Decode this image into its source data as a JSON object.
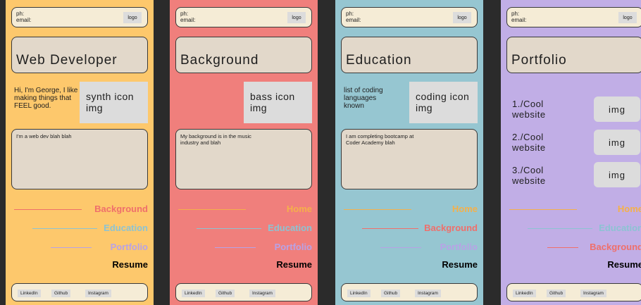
{
  "colors": {
    "dark_bg": "#2b2b2b",
    "orange": "#fdc86c",
    "red": "#f07f7c",
    "blue": "#96c6d1",
    "purple": "#c1aee6",
    "nav_orange": "#f5b04a",
    "nav_red": "#ef6f6b",
    "nav_blue": "#8cc3d3",
    "nav_purple": "#b8a2e6"
  },
  "header": {
    "ph_label": "ph:",
    "email_label": "email:",
    "logo": "logo"
  },
  "footer": {
    "linkedin": "LinkedIn",
    "github": "Github",
    "instagram": "Instagram"
  },
  "panels": [
    {
      "title": "Web Developer",
      "intro": "Hi, I'm George, I like making things that FEEL good.",
      "icon": "synth icon img",
      "description": "I'm a web dev blah blah",
      "nav": [
        "Background",
        "Education",
        "Portfolio",
        "Resume"
      ]
    },
    {
      "title": "Background",
      "icon": "bass icon img",
      "description": "My background is in the music industry and blah",
      "nav": [
        "Home",
        "Education",
        "Portfolio",
        "Resume"
      ]
    },
    {
      "title": "Education",
      "intro": "list of coding languages known",
      "icon": "coding icon img",
      "description": "I am completing bootcamp at Coder Academy blah",
      "nav": [
        "Home",
        "Background",
        "Portfolio",
        "Resume"
      ]
    },
    {
      "title": "Portfolio",
      "items": [
        "1./Cool website",
        "2./Cool website",
        "3./Cool website"
      ],
      "img_label": "img",
      "nav": [
        "Home",
        "Education",
        "Background",
        "Resume"
      ]
    }
  ]
}
